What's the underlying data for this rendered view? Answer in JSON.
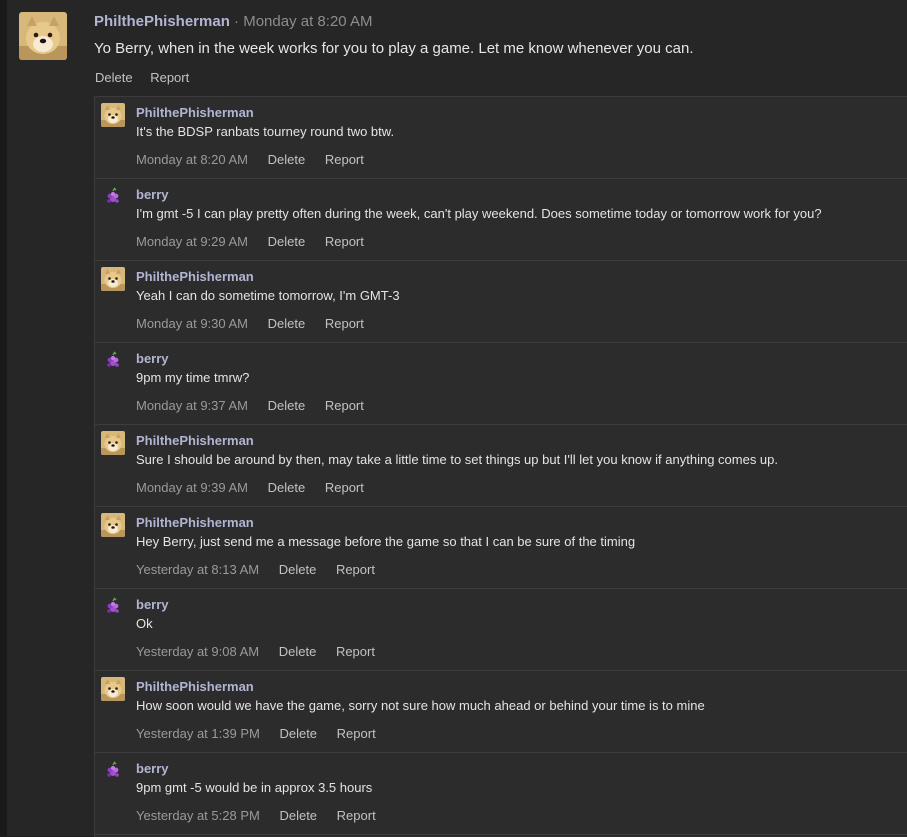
{
  "post": {
    "author": "PhilthePhisherman",
    "separator": "·",
    "time": "Monday at 8:20 AM",
    "body": "Yo Berry, when in the week works for you to play a game. Let me know whenever you can.",
    "actions": {
      "delete": "Delete",
      "report": "Report"
    }
  },
  "comments": [
    {
      "author": "PhilthePhisherman",
      "avatar": "doge-avatar",
      "text": "It's the BDSP ranbats tourney round two btw.",
      "time": "Monday at 8:20 AM",
      "delete": "Delete",
      "report": "Report"
    },
    {
      "author": "berry",
      "avatar": "berry-avatar",
      "text": "I'm gmt -5 I can play pretty often during the week, can't play weekend. Does sometime today or tomorrow work for you?",
      "time": "Monday at 9:29 AM",
      "delete": "Delete",
      "report": "Report"
    },
    {
      "author": "PhilthePhisherman",
      "avatar": "doge-avatar",
      "text": "Yeah I can do sometime tomorrow, I'm GMT-3",
      "time": "Monday at 9:30 AM",
      "delete": "Delete",
      "report": "Report"
    },
    {
      "author": "berry",
      "avatar": "berry-avatar",
      "text": "9pm my time tmrw?",
      "time": "Monday at 9:37 AM",
      "delete": "Delete",
      "report": "Report"
    },
    {
      "author": "PhilthePhisherman",
      "avatar": "doge-avatar",
      "text": "Sure I should be around by then, may take a little time to set things up but I'll let you know if anything comes up.",
      "time": "Monday at 9:39 AM",
      "delete": "Delete",
      "report": "Report"
    },
    {
      "author": "PhilthePhisherman",
      "avatar": "doge-avatar",
      "text": "Hey Berry, just send me a message before the game so that I can be sure of the timing",
      "time": "Yesterday at 8:13 AM",
      "delete": "Delete",
      "report": "Report"
    },
    {
      "author": "berry",
      "avatar": "berry-avatar",
      "text": "Ok",
      "time": "Yesterday at 9:08 AM",
      "delete": "Delete",
      "report": "Report"
    },
    {
      "author": "PhilthePhisherman",
      "avatar": "doge-avatar",
      "text": "How soon would we have the game, sorry not sure how much ahead or behind your time is to mine",
      "time": "Yesterday at 1:39 PM",
      "delete": "Delete",
      "report": "Report"
    },
    {
      "author": "berry",
      "avatar": "berry-avatar",
      "text": "9pm gmt -5 would be in approx 3.5 hours",
      "time": "Yesterday at 5:28 PM",
      "delete": "Delete",
      "report": "Report"
    }
  ]
}
